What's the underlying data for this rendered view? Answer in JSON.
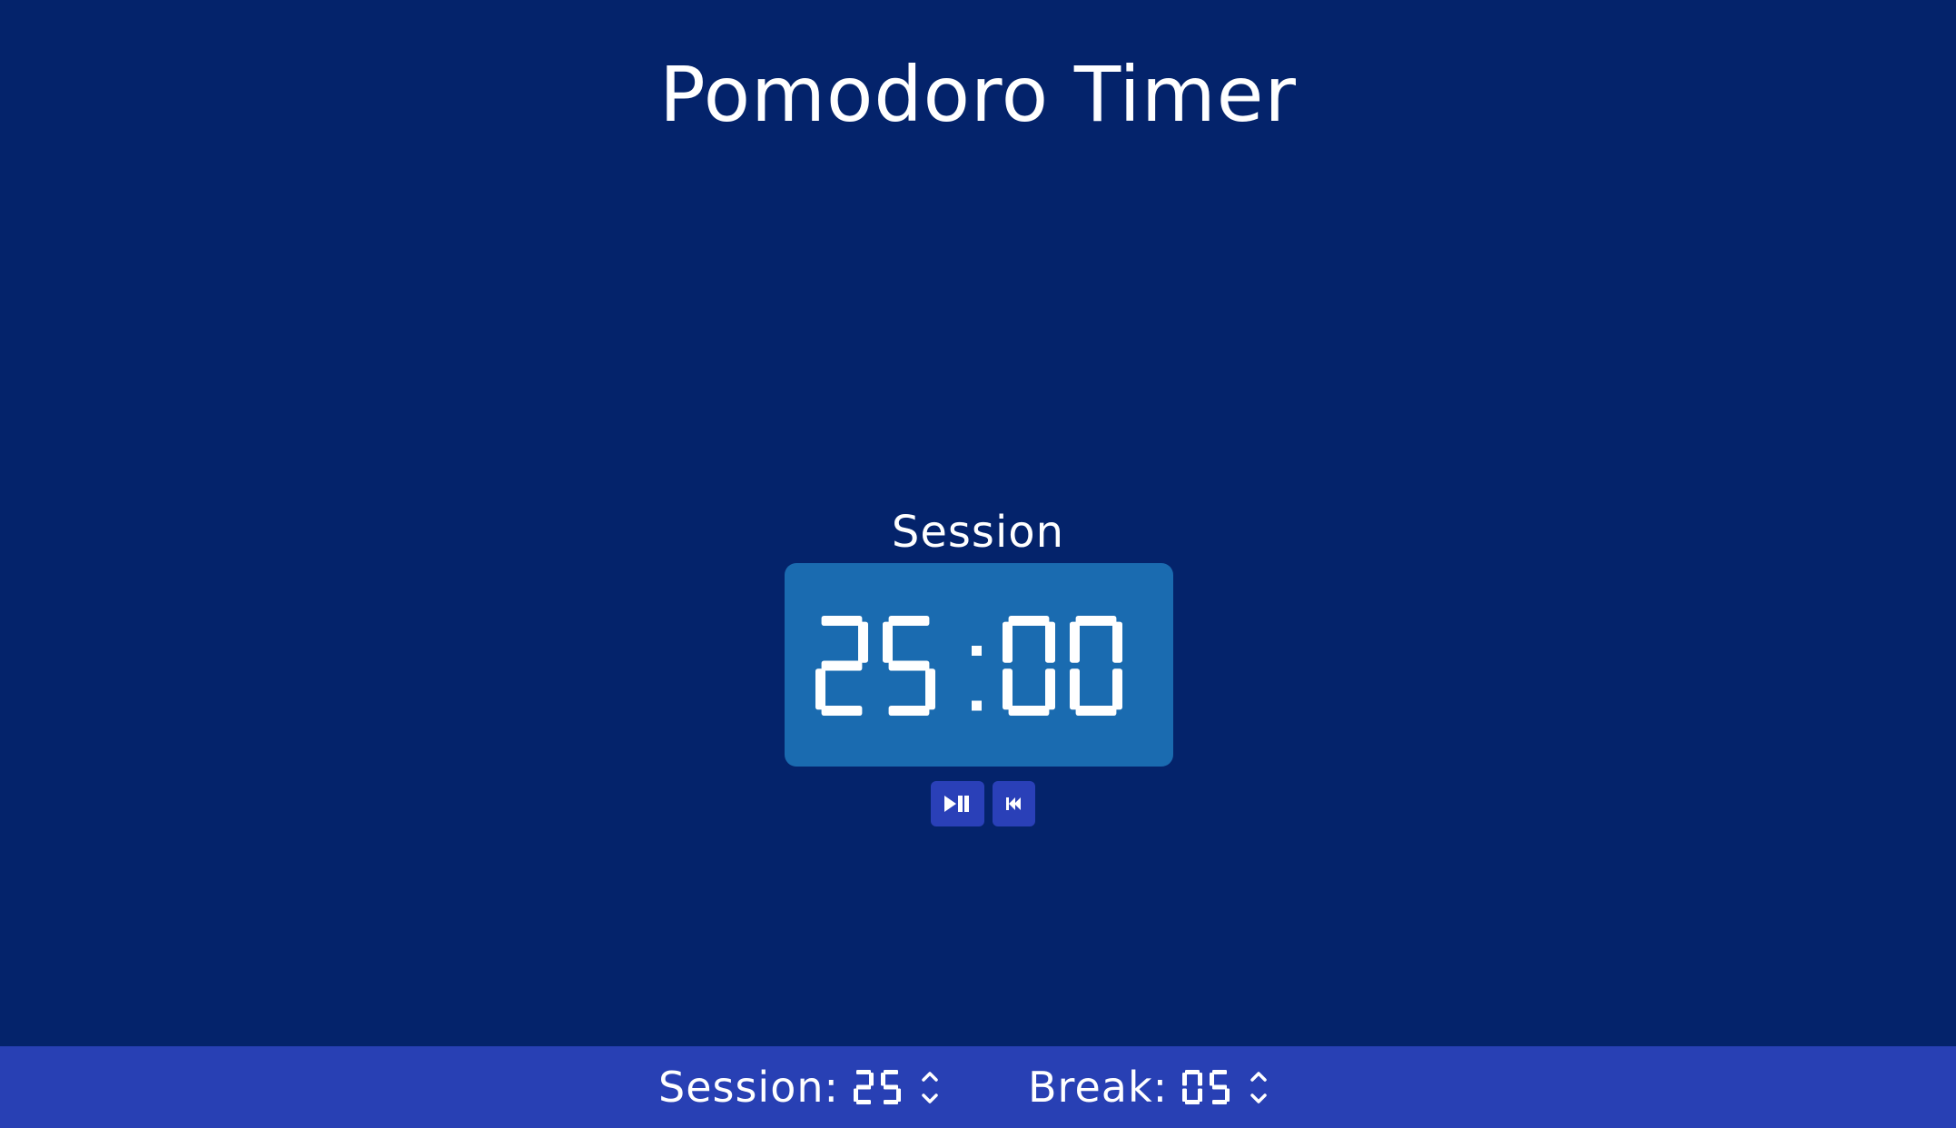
{
  "header": {
    "title": "Pomodoro Timer"
  },
  "timer": {
    "label": "Session",
    "time": "25:00",
    "display_color": "#1a6bb0"
  },
  "controls": {
    "play_pause_icon": "play-pause-icon",
    "reset_icon": "skip-back-icon"
  },
  "footer": {
    "session_label": "Session:",
    "session_value": "25",
    "break_label": "Break:",
    "break_value": "05"
  },
  "colors": {
    "background": "#04236b",
    "footer": "#2840b4",
    "button": "#2a40b8",
    "text": "#ffffff"
  }
}
